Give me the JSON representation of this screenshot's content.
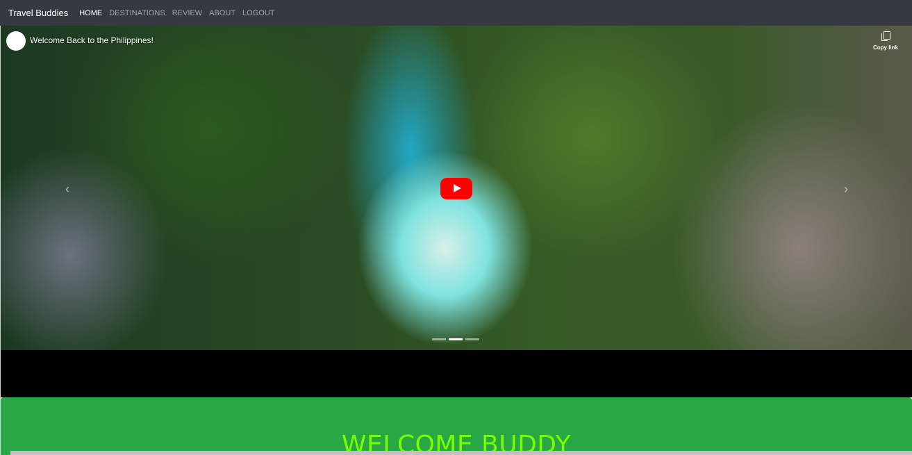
{
  "navbar": {
    "brand": "Travel Buddies",
    "links": [
      {
        "label": "HOME",
        "active": true
      },
      {
        "label": "DESTINATIONS",
        "active": false
      },
      {
        "label": "REVIEW",
        "active": false
      },
      {
        "label": "ABOUT",
        "active": false
      },
      {
        "label": "LOGOUT",
        "active": false
      }
    ]
  },
  "video": {
    "title": "Welcome Back to the Philippines!",
    "copy_link_label": "Copy link",
    "play_icon": "youtube-play-icon",
    "prev_icon": "chevron-left-icon",
    "next_icon": "chevron-right-icon",
    "indicators": 3,
    "active_indicator": 2
  },
  "welcome": {
    "heading": "WELCOME BUDDY"
  },
  "colors": {
    "navbar_bg": "#343a40",
    "section_green": "#28a745",
    "heading_green": "#7cfc00",
    "play_red": "#ff0000"
  }
}
